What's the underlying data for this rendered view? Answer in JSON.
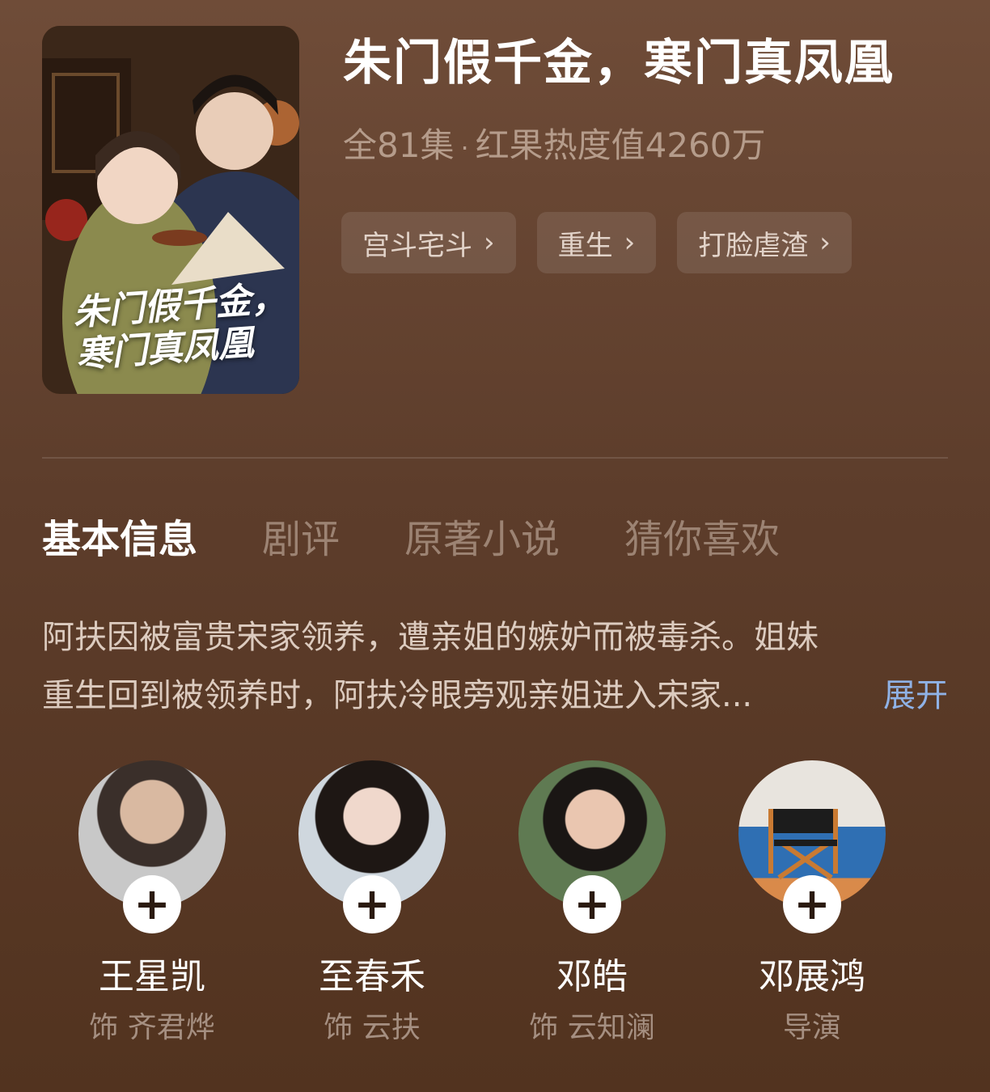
{
  "drama": {
    "title": "朱门假千金，寒门真凤凰",
    "poster_calligraphy": "朱门假千金，寒门真凤凰",
    "episodes": "全81集",
    "separator": "·",
    "heat": "红果热度值4260万"
  },
  "tags": [
    {
      "label": "宫斗宅斗",
      "icon": "chevron-right-icon"
    },
    {
      "label": "重生",
      "icon": "chevron-right-icon"
    },
    {
      "label": "打脸虐渣",
      "icon": "chevron-right-icon"
    }
  ],
  "tabs": [
    {
      "label": "基本信息",
      "active": true
    },
    {
      "label": "剧评",
      "active": false
    },
    {
      "label": "原著小说",
      "active": false
    },
    {
      "label": "猜你喜欢",
      "active": false
    }
  ],
  "synopsis": {
    "line1": "阿扶因被富贵宋家领养，遭亲姐的嫉妒而被毒杀。姐妹",
    "line2": "重生回到被领养时，阿扶冷眼旁观亲姐进入宋家...",
    "expand_label": "展开"
  },
  "cast": [
    {
      "name": "王星凯",
      "role": "饰 齐君烨",
      "add_icon": "+"
    },
    {
      "name": "至春禾",
      "role": "饰 云扶",
      "add_icon": "+"
    },
    {
      "name": "邓皓",
      "role": "饰 云知澜",
      "add_icon": "+"
    },
    {
      "name": "邓展鸿",
      "role": "导演",
      "add_icon": "+"
    }
  ],
  "colors": {
    "background": "#5d3d2b",
    "link": "#8fb2e6",
    "tag_bg": "rgba(255,255,255,0.10)"
  }
}
